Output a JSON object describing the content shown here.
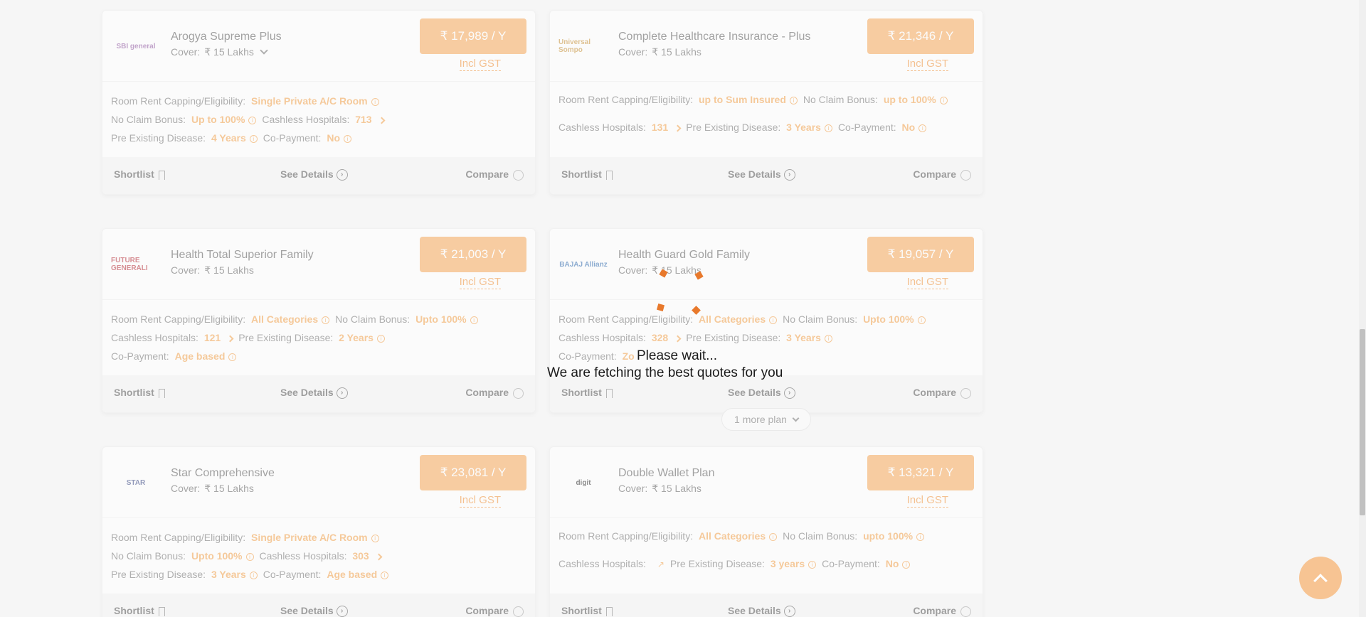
{
  "cards": [
    {
      "logo": "SBI general",
      "logo_color": "#8a4f9c",
      "name": "Arogya Supreme Plus",
      "cover_label": "Cover:",
      "cover_value": "₹ 15 Lakhs",
      "price": "₹ 17,989 / Y",
      "gst": "Incl GST",
      "rows": [
        [
          {
            "k": "Room Rent Capping/Eligibility:",
            "v": "Single Private A/C Room",
            "icon": "info"
          }
        ],
        [
          {
            "k": "No Claim Bonus:",
            "v": "Up to 100%",
            "icon": "info"
          },
          {
            "k": "Cashless Hospitals:",
            "v": "713",
            "icon": "arrow"
          }
        ],
        [
          {
            "k": "Pre Existing Disease:",
            "v": "4 Years",
            "icon": "info"
          },
          {
            "k": "Co-Payment:",
            "v": "No",
            "icon": "info"
          }
        ]
      ]
    },
    {
      "logo": "Universal Sompo",
      "logo_color": "#c58a2b",
      "name": "Complete Healthcare Insurance - Plus",
      "cover_label": "Cover:",
      "cover_value": "₹ 15 Lakhs",
      "price": "₹ 21,346 / Y",
      "gst": "Incl GST",
      "rows": [
        [
          {
            "k": "Room Rent Capping/Eligibility:",
            "v": "up to Sum Insured",
            "icon": "info"
          },
          {
            "k": "No Claim Bonus:",
            "v": "up to 100%",
            "icon": "info"
          }
        ],
        [
          {
            "k": "Cashless Hospitals:",
            "v": "131",
            "icon": "arrow"
          },
          {
            "k": "Pre Existing Disease:",
            "v": "3 Years",
            "icon": "info"
          },
          {
            "k": "Co-Payment:",
            "v": "No",
            "icon": "info"
          }
        ]
      ]
    },
    {
      "logo": "FUTURE GENERALI",
      "logo_color": "#b5242f",
      "name": "Health Total Superior Family",
      "cover_label": "Cover:",
      "cover_value": "₹ 15 Lakhs",
      "price": "₹ 21,003 / Y",
      "gst": "Incl GST",
      "rows": [
        [
          {
            "k": "Room Rent Capping/Eligibility:",
            "v": "All Categories",
            "icon": "info"
          },
          {
            "k": "No Claim Bonus:",
            "v": "Upto 100%",
            "icon": "info"
          }
        ],
        [
          {
            "k": "Cashless Hospitals:",
            "v": "121",
            "icon": "arrow"
          },
          {
            "k": "Pre Existing Disease:",
            "v": "2 Years",
            "icon": "info"
          }
        ],
        [
          {
            "k": "Co-Payment:",
            "v": "Age based",
            "icon": "info"
          }
        ]
      ]
    },
    {
      "logo": "BAJAJ Allianz",
      "logo_color": "#1f5fa8",
      "name": "Health Guard Gold Family",
      "cover_label": "Cover:",
      "cover_value": "₹ 15 Lakhs",
      "price": "₹ 19,057 / Y",
      "gst": "Incl GST",
      "rows": [
        [
          {
            "k": "Room Rent Capping/Eligibility:",
            "v": "All Categories",
            "icon": "info"
          },
          {
            "k": "No Claim Bonus:",
            "v": "Upto 100%",
            "icon": "info"
          }
        ],
        [
          {
            "k": "Cashless Hospitals:",
            "v": "328",
            "icon": "arrow"
          },
          {
            "k": "Pre Existing Disease:",
            "v": "3 Years",
            "icon": "info"
          }
        ],
        [
          {
            "k": "Co-Payment:",
            "v": "Zo",
            "icon": "none"
          }
        ]
      ]
    },
    {
      "logo": "STAR",
      "logo_color": "#2a3a7a",
      "name": "Star Comprehensive",
      "cover_label": "Cover:",
      "cover_value": "₹ 15 Lakhs",
      "price": "₹ 23,081 / Y",
      "gst": "Incl GST",
      "rows": [
        [
          {
            "k": "Room Rent Capping/Eligibility:",
            "v": "Single Private A/C Room",
            "icon": "info"
          }
        ],
        [
          {
            "k": "No Claim Bonus:",
            "v": "Upto 100%",
            "icon": "info"
          },
          {
            "k": "Cashless Hospitals:",
            "v": "303",
            "icon": "arrow"
          }
        ],
        [
          {
            "k": "Pre Existing Disease:",
            "v": "3 Years",
            "icon": "info"
          },
          {
            "k": "Co-Payment:",
            "v": "Age based",
            "icon": "info"
          }
        ]
      ]
    },
    {
      "logo": "digit",
      "logo_color": "#1a1a1a",
      "name": "Double Wallet Plan",
      "cover_label": "Cover:",
      "cover_value": "₹ 15 Lakhs",
      "price": "₹ 13,321 / Y",
      "gst": "Incl GST",
      "rows": [
        [
          {
            "k": "Room Rent Capping/Eligibility:",
            "v": "All Categories",
            "icon": "info"
          },
          {
            "k": "No Claim Bonus:",
            "v": "upto 100%",
            "icon": "info"
          }
        ],
        [
          {
            "k": "Cashless Hospitals:",
            "v": "",
            "icon": "external"
          },
          {
            "k": "Pre Existing Disease:",
            "v": "3 years",
            "icon": "info"
          },
          {
            "k": "Co-Payment:",
            "v": "No",
            "icon": "info"
          }
        ]
      ]
    }
  ],
  "footer": {
    "shortlist": "Shortlist",
    "details": "See Details",
    "compare": "Compare"
  },
  "more_plan": "1 more plan",
  "loading": {
    "title": "Please wait...",
    "subtitle": "We are fetching the best quotes for you"
  },
  "accent_color": "#f7a04a"
}
